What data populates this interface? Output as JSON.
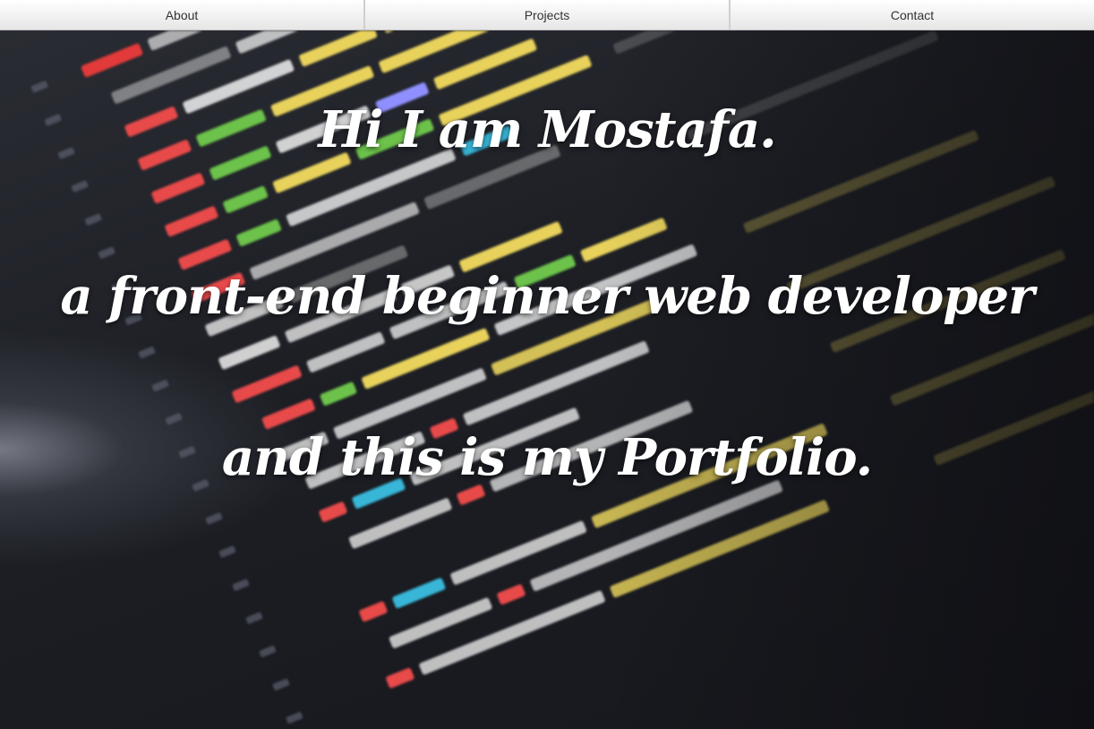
{
  "nav": {
    "items": [
      {
        "label": "About"
      },
      {
        "label": "Projects"
      },
      {
        "label": "Contact"
      }
    ]
  },
  "hero": {
    "line1": "Hi I am Mostafa.",
    "line2": "a front-end beginner web developer",
    "line3": "and this is my Portfolio."
  },
  "colors": {
    "nav_bg": "#f2f2f2",
    "hero_text": "#ffffff"
  }
}
